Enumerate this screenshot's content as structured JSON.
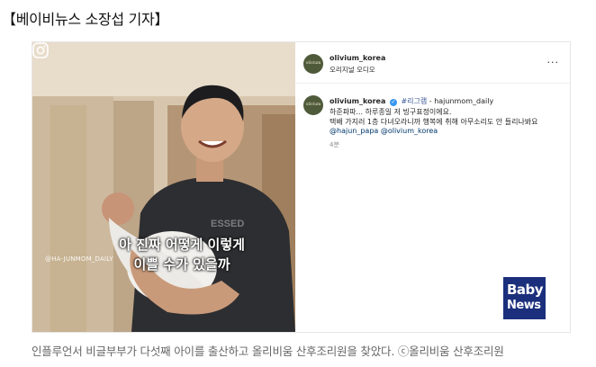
{
  "header": {
    "byline": "【베이비뉴스 소장섭 기자】"
  },
  "photo": {
    "caption_line1": "아 진짜 어떻게 이렇게",
    "caption_line2": "이쁠 수가 있을까",
    "watermark_handle": "@HA-JUNMOM_DAILY",
    "shirt_text": "ESSED"
  },
  "instagram": {
    "account": "olivium_korea",
    "audio_label": "오리지널 오디오",
    "more_icon": "···",
    "avatar_text": "olivium",
    "comment": {
      "author": "olivium_korea",
      "tag": "#리그램",
      "source": "- hajunmom_daily",
      "line2": "하준파파... 하루종일 저 빙구표정이에요.",
      "line3": "택배 가지러 1층 다녀오라니까 행복에 취해 아무소리도 안 들리나봐요",
      "mentions": "@hajun_papa @olivium_korea",
      "time": "4분"
    }
  },
  "logo": {
    "line1": "Baby",
    "line2": "News"
  },
  "caption": {
    "text": "인플루언서 비글부부가 다섯째 아이를 출산하고 올리비움 산후조리원을 찾았다. ⓒ올리비움 산후조리원"
  },
  "colors": {
    "logo_bg": "#1b2f7c",
    "link": "#00376b",
    "verified": "#3897f0"
  }
}
